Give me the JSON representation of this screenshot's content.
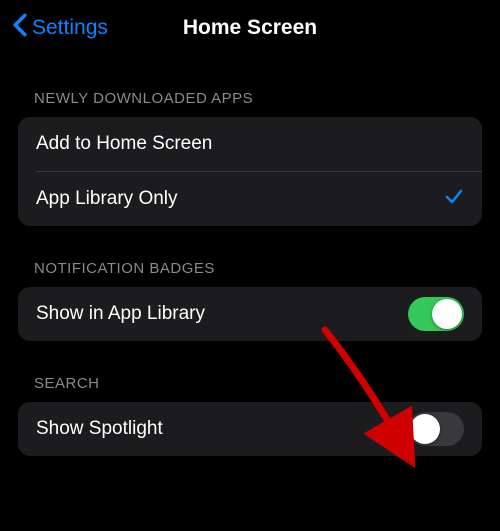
{
  "nav": {
    "back_label": "Settings",
    "title": "Home Screen"
  },
  "sections": {
    "newly_downloaded": {
      "header": "NEWLY DOWNLOADED APPS",
      "add_to_home": "Add to Home Screen",
      "app_library_only": "App Library Only",
      "selected": "app_library_only"
    },
    "notification_badges": {
      "header": "NOTIFICATION BADGES",
      "show_in_app_library": "Show in App Library",
      "show_in_app_library_enabled": true
    },
    "search": {
      "header": "SEARCH",
      "show_spotlight": "Show Spotlight",
      "show_spotlight_enabled": false
    }
  },
  "colors": {
    "accent": "#0a84ff",
    "toggle_on": "#34c759",
    "toggle_off": "#39393d",
    "row_bg": "#1c1c1e",
    "arrow": "#d00000"
  }
}
